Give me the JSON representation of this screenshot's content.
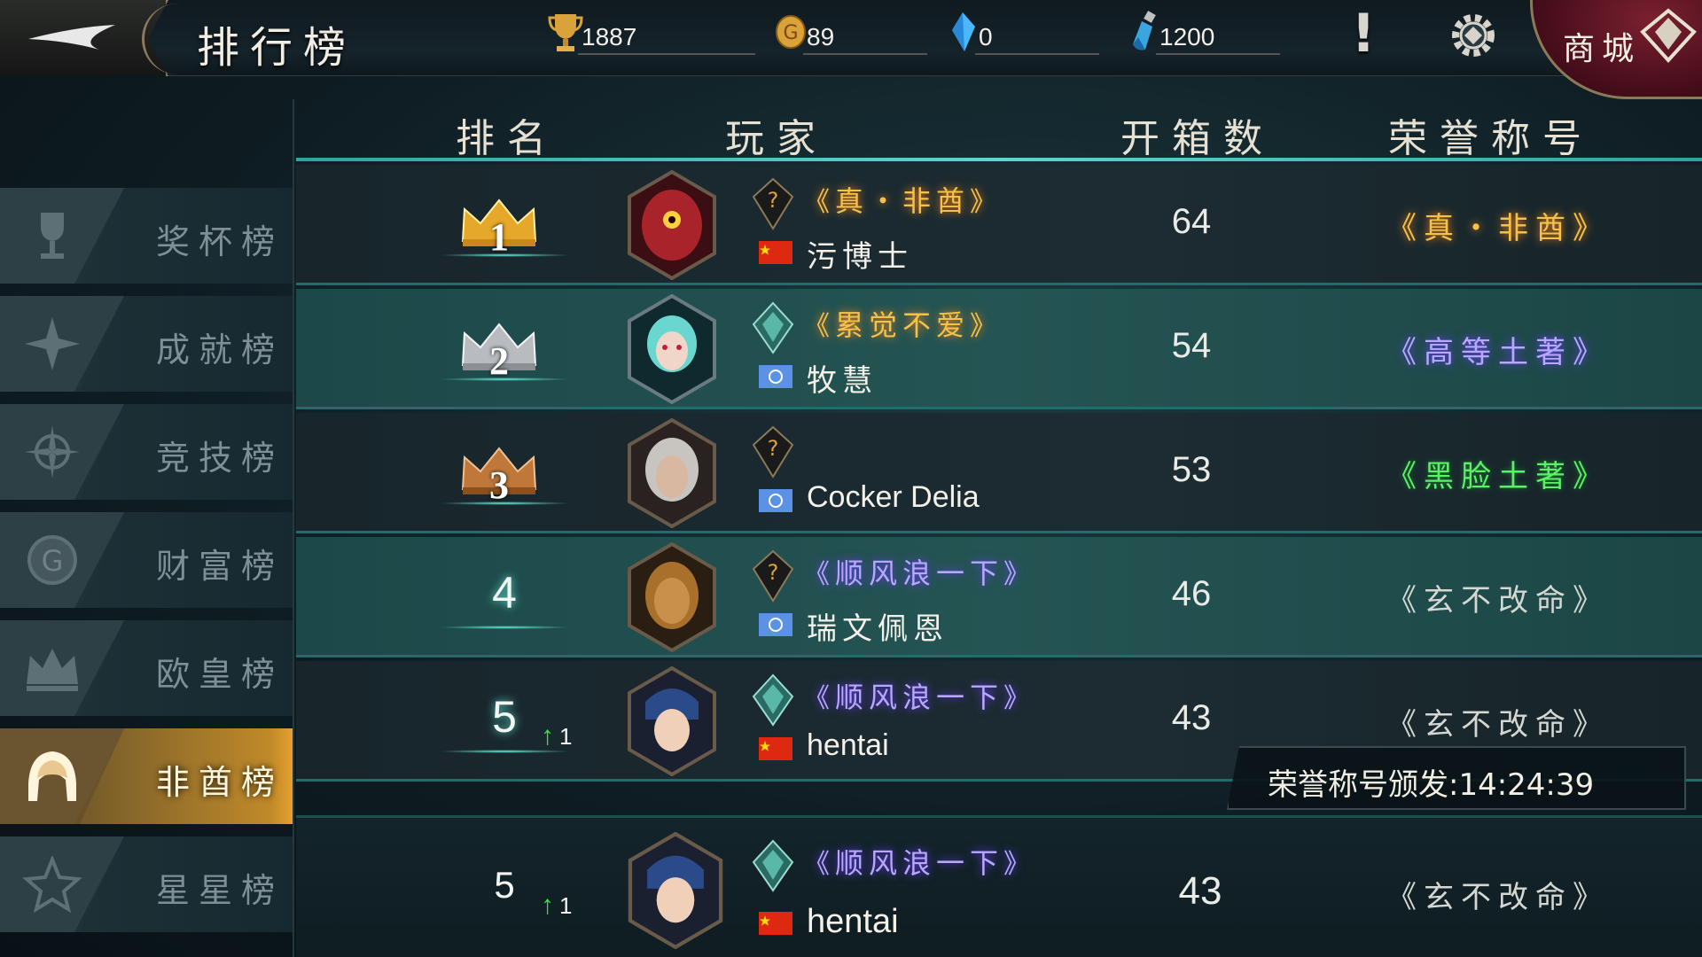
{
  "header": {
    "title": "排行榜",
    "resources": [
      {
        "icon": "trophy-icon",
        "value": "1887"
      },
      {
        "icon": "coin-icon",
        "value": "89"
      },
      {
        "icon": "crystal-icon",
        "value": "0"
      },
      {
        "icon": "potion-icon",
        "value": "1200"
      }
    ],
    "shop_label": "商城"
  },
  "sidebar": {
    "items": [
      {
        "label": "奖杯榜",
        "icon": "trophy-icon",
        "active": false
      },
      {
        "label": "成就榜",
        "icon": "achievement-star-icon",
        "active": false
      },
      {
        "label": "竞技榜",
        "icon": "arena-compass-icon",
        "active": false
      },
      {
        "label": "财富榜",
        "icon": "coin-icon",
        "active": false
      },
      {
        "label": "欧皇榜",
        "icon": "crown-icon",
        "active": false
      },
      {
        "label": "非酋榜",
        "icon": "hood-icon",
        "active": true
      },
      {
        "label": "星星榜",
        "icon": "star-icon",
        "active": false
      }
    ]
  },
  "table": {
    "headers": {
      "rank": "排名",
      "player": "玩家",
      "boxes": "开箱数",
      "honor": "荣誉称号"
    },
    "rows": [
      {
        "rank": "1",
        "crown": "gold",
        "change": "",
        "player_title": "真・非酋",
        "player_title_color": "gold",
        "flag": "china",
        "name": "污博士",
        "boxes": "64",
        "honor": "真・非酋",
        "honor_color": "gold"
      },
      {
        "rank": "2",
        "crown": "silver",
        "change": "",
        "player_title": "累觉不爱",
        "player_title_color": "gold",
        "flag": "un",
        "name": "牧慧",
        "boxes": "54",
        "honor": "高等土著",
        "honor_color": "purple"
      },
      {
        "rank": "3",
        "crown": "bronze",
        "change": "",
        "player_title": "",
        "player_title_color": "gold",
        "flag": "un",
        "name": "Cocker Delia",
        "boxes": "53",
        "honor": "黑脸土著",
        "honor_color": "green"
      },
      {
        "rank": "4",
        "crown": "",
        "change": "",
        "player_title": "顺风浪一下",
        "player_title_color": "purple",
        "flag": "un",
        "name": "瑞文佩恩",
        "boxes": "46",
        "honor": "玄不改命",
        "honor_color": "gray"
      },
      {
        "rank": "5",
        "crown": "",
        "change": "1",
        "player_title": "顺风浪一下",
        "player_title_color": "purple",
        "flag": "china",
        "name": "hentai",
        "boxes": "43",
        "honor": "玄不改命",
        "honor_color": "gray"
      }
    ],
    "own_row": {
      "rank": "5",
      "change": "1",
      "player_title": "顺风浪一下",
      "flag": "china",
      "name": "hentai",
      "boxes": "43",
      "honor": "玄不改命"
    }
  },
  "timer": {
    "text": "荣誉称号颁发:14:24:39"
  },
  "colors": {
    "accent_teal": "#2aa6a2",
    "gold": "#f4c24a",
    "purple": "#b8a6ff",
    "green": "#5ef06a",
    "shop_red": "#7a2030"
  }
}
